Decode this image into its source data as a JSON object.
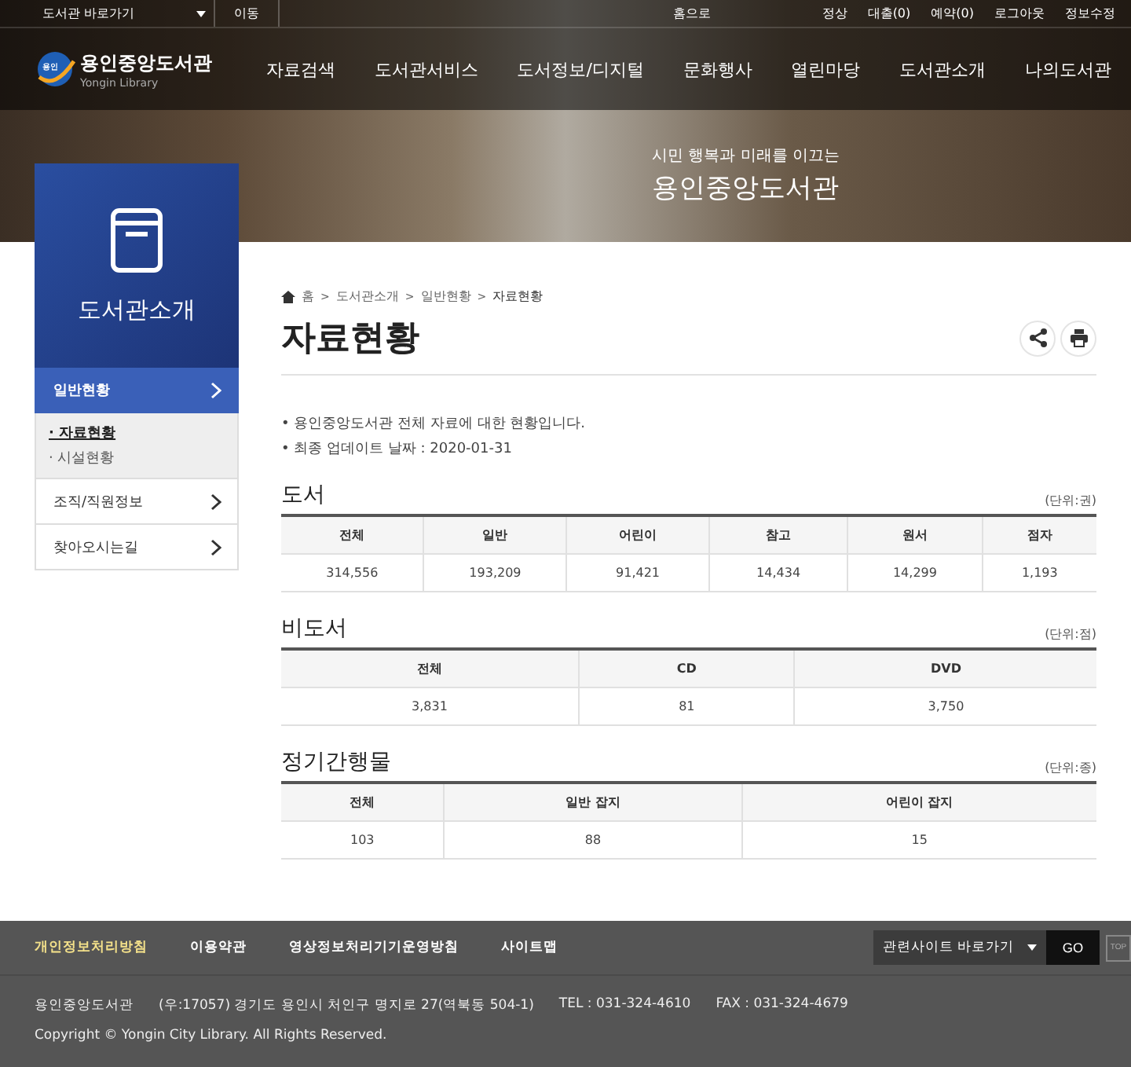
{
  "top_bar": {
    "library_select": "도서관 바로가기",
    "go_button": "이동",
    "home_link": "홈으로",
    "user_links": [
      "정상",
      "대출(0)",
      "예약(0)",
      "로그아웃",
      "정보수정"
    ]
  },
  "logo": {
    "name": "용인중앙도서관",
    "subtitle": "Yongin Library",
    "badge": "용인"
  },
  "nav": [
    "자료검색",
    "도서관서비스",
    "도서정보/디지털",
    "문화행사",
    "열린마당",
    "도서관소개",
    "나의도서관"
  ],
  "hero": {
    "tagline": "시민 행복과 미래를 이끄는",
    "title": "용인중앙도서관"
  },
  "sidebar": {
    "title": "도서관소개",
    "items": [
      {
        "label": "일반현황",
        "selected": true,
        "children": [
          {
            "label": "· 자료현황",
            "selected": true
          },
          {
            "label": "· 시설현황",
            "selected": false
          }
        ]
      },
      {
        "label": "조직/직원정보",
        "selected": false
      },
      {
        "label": "찾아오시는길",
        "selected": false
      }
    ]
  },
  "breadcrumb": [
    "홈",
    "도서관소개",
    "일반현황",
    "자료현황"
  ],
  "breadcrumb_separator": ">",
  "page_title": "자료현황",
  "notes": [
    "• 용인중앙도서관 전체 자료에 대한 현황입니다.",
    "• 최종 업데이트 날짜 : 2020-01-31"
  ],
  "sections": [
    {
      "title": "도서",
      "unit": "(단위:권)",
      "columns": [
        "전체",
        "일반",
        "어린이",
        "참고",
        "원서",
        "점자"
      ],
      "row": [
        "314,556",
        "193,209",
        "91,421",
        "14,434",
        "14,299",
        "1,193"
      ]
    },
    {
      "title": "비도서",
      "unit": "(단위:점)",
      "columns": [
        "전체",
        "CD",
        "DVD"
      ],
      "row": [
        "3,831",
        "81",
        "3,750"
      ]
    },
    {
      "title": "정기간행물",
      "unit": "(단위:종)",
      "columns": [
        "전체",
        "일반 잡지",
        "어린이 잡지"
      ],
      "row": [
        "103",
        "88",
        "15"
      ]
    }
  ],
  "footer": {
    "links": [
      {
        "label": "개인정보처리방침",
        "highlighted": true
      },
      {
        "label": "이용약관",
        "highlighted": false
      },
      {
        "label": "영상정보처리기기운영방침",
        "highlighted": false
      },
      {
        "label": "사이트맵",
        "highlighted": false
      }
    ],
    "site_select": "관련사이트 바로가기",
    "go_button": "GO",
    "top_button": "TOP",
    "info": [
      "용인중앙도서관",
      "(우:17057) 경기도 용인시 처인구 명지로 27(역북동 504-1)",
      "TEL : 031-324-4610",
      "FAX : 031-324-4679"
    ],
    "copyright": "Copyright © Yongin City Library. All Rights Reserved."
  }
}
